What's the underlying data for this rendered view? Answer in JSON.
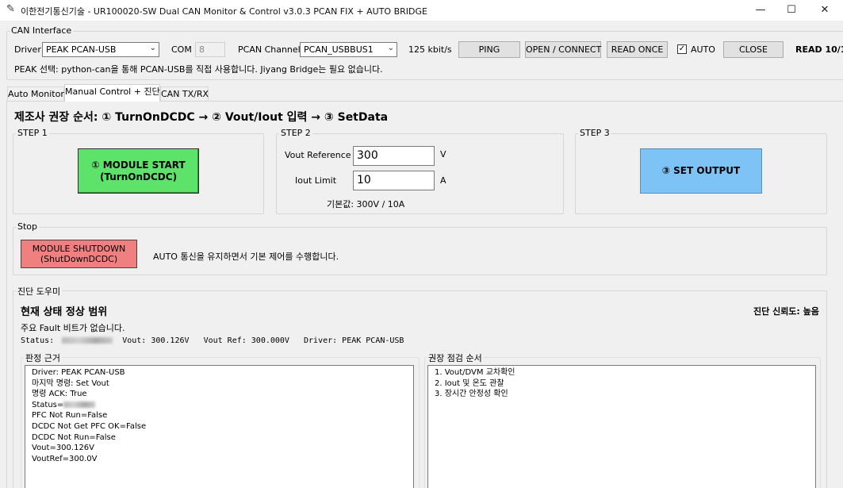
{
  "window": {
    "title": "이한전기통신기술 - UR100020-SW Dual CAN Monitor & Control v3.0.3 PCAN FIX + AUTO BRIDGE",
    "minimize": "—",
    "maximize": "☐",
    "close": "✕"
  },
  "can_interface": {
    "group_label": "CAN Interface",
    "driver_label": "Driver",
    "driver_value": "PEAK PCAN-USB",
    "com_label": "COM",
    "com_value": "8",
    "pcan_channel_label": "PCAN Channel",
    "pcan_channel_value": "PCAN_USBBUS1",
    "bitrate": "125 kbit/s",
    "ping_label": "PING",
    "open_connect_label": "OPEN / CONNECT",
    "read_once_label": "READ ONCE",
    "auto_label": "AUTO",
    "auto_checked": true,
    "close_label": "CLOSE",
    "read_status": "READ 10/1",
    "note": "PEAK 선택: python-can을 통해 PCAN-USB를 직접 사용합니다. Jiyang Bridge는 필요 없습니다."
  },
  "tabs": [
    {
      "label": "Auto Monitor",
      "active": false
    },
    {
      "label": "Manual Control + 진단",
      "active": true
    },
    {
      "label": "CAN TX/RX",
      "active": false
    }
  ],
  "manual": {
    "heading": "제조사 권장 순서: ① TurnOnDCDC → ② Vout/Iout 입력 → ③ SetData",
    "step1": {
      "label": "STEP 1",
      "button_line1": "① MODULE START",
      "button_line2": "(TurnOnDCDC)",
      "button_color": "#5ee36a"
    },
    "step2": {
      "label": "STEP 2",
      "vout_label": "Vout Reference",
      "vout_value": "300",
      "vout_unit": "V",
      "iout_label": "Iout Limit",
      "iout_value": "10",
      "iout_unit": "A",
      "default_text": "기본값: 300V / 10A"
    },
    "step3": {
      "label": "STEP 3",
      "button_label": "③ SET OUTPUT",
      "button_color": "#7ec3f5"
    },
    "stop": {
      "label": "Stop",
      "button_line1": "MODULE SHUTDOWN",
      "button_line2": "(ShutDownDCDC)",
      "button_color": "#f08080",
      "note": "AUTO 통신을 유지하면서 기본 제어를 수행합니다."
    },
    "diagnosis": {
      "label": "진단 도우미",
      "state_title": "현재 상태 정상 범위",
      "confidence": "진단 신뢰도: 높음",
      "fault_text": "주요 Fault 비트가 없습니다.",
      "status_label": "Status:",
      "vout_text": "Vout: 300.126V",
      "vout_ref_text": "Vout Ref: 300.000V",
      "driver_text": "Driver: PEAK PCAN-USB",
      "evidence_label": "판정 근거",
      "evidence_lines": [
        "Driver: PEAK PCAN-USB",
        "마지막 명령: Set Vout",
        "명령 ACK: True",
        "Status=",
        "PFC Not Run=False",
        "DCDC Not Get PFC OK=False",
        "DCDC Not Run=False",
        "Vout=300.126V",
        "VoutRef=300.0V"
      ],
      "checklist_label": "권장 점검 순서",
      "checklist_lines": [
        "1. Vout/DVM 교차확인",
        "2. Iout 및 온도 관찰",
        "3. 장시간 안정성 확인"
      ]
    }
  }
}
